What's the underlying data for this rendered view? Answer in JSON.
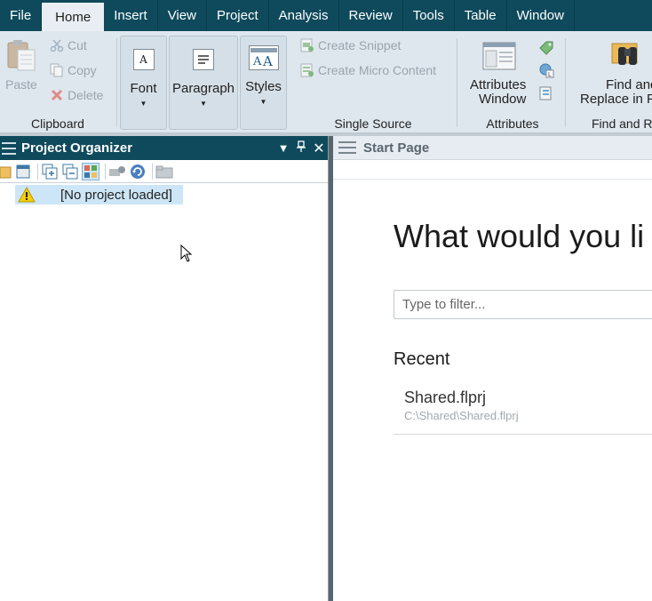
{
  "menu": {
    "tabs": [
      "File",
      "Home",
      "Insert",
      "View",
      "Project",
      "Analysis",
      "Review",
      "Tools",
      "Table",
      "Window"
    ],
    "active": "Home"
  },
  "ribbon": {
    "clipboard": {
      "paste_label": "Paste",
      "cut_label": "Cut",
      "copy_label": "Copy",
      "delete_label": "Delete",
      "group_label": "Clipboard"
    },
    "formatting": {
      "font_label": "Font",
      "paragraph_label": "Paragraph",
      "styles_label": "Styles"
    },
    "single_source": {
      "create_snippet_label": "Create Snippet",
      "create_micro_content_label": "Create Micro Content",
      "group_label": "Single Source"
    },
    "attributes": {
      "window_label_line1": "Attributes",
      "window_label_line2": "Window",
      "group_label": "Attributes"
    },
    "find": {
      "label_line1": "Find and",
      "label_line2": "Replace in Fi",
      "group_label": "Find and R"
    }
  },
  "project_organizer": {
    "title": "Project Organizer",
    "empty_item": "[No project loaded]"
  },
  "start_page": {
    "tab_title": "Start Page",
    "headline": "What would you li",
    "filter_placeholder": "Type to filter...",
    "recent_heading": "Recent",
    "recent_items": [
      {
        "name": "Shared.flprj",
        "path": "C:\\Shared\\Shared.flprj"
      }
    ]
  },
  "colors": {
    "title_bar": "#0e4a5c",
    "ribbon_bg": "#dfe7ee",
    "selection": "#cde6f7"
  }
}
